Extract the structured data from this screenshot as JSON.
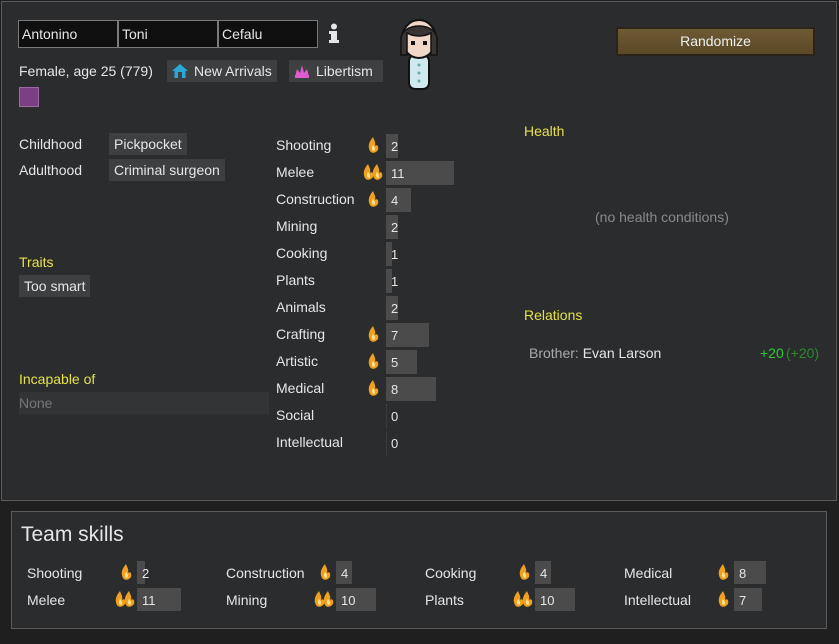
{
  "names": {
    "first": "Antonino",
    "nick": "Toni",
    "last": "Cefalu"
  },
  "summary": "Female, age 25 (779)",
  "faction_chips": [
    {
      "label": "New Arrivals",
      "icon": "house-icon"
    },
    {
      "label": "Libertism",
      "icon": "ideology-icon"
    }
  ],
  "randomize_label": "Randomize",
  "backstory": {
    "childhood_label": "Childhood",
    "childhood": "Pickpocket",
    "adulthood_label": "Adulthood",
    "adulthood": "Criminal surgeon"
  },
  "traits_title": "Traits",
  "traits": [
    "Too smart"
  ],
  "incapable_title": "Incapable of",
  "incapable_value": "None",
  "health_title": "Health",
  "health_empty": "(no health conditions)",
  "relations_title": "Relations",
  "relations": [
    {
      "type": "Brother:",
      "name": "Evan Larson",
      "opinion": "+20",
      "opinion_base": "(+20)"
    }
  ],
  "skills": [
    {
      "name": "Shooting",
      "level": 2,
      "passion": 1
    },
    {
      "name": "Melee",
      "level": 11,
      "passion": 2
    },
    {
      "name": "Construction",
      "level": 4,
      "passion": 1
    },
    {
      "name": "Mining",
      "level": 2,
      "passion": 0
    },
    {
      "name": "Cooking",
      "level": 1,
      "passion": 0
    },
    {
      "name": "Plants",
      "level": 1,
      "passion": 0
    },
    {
      "name": "Animals",
      "level": 2,
      "passion": 0
    },
    {
      "name": "Crafting",
      "level": 7,
      "passion": 1
    },
    {
      "name": "Artistic",
      "level": 5,
      "passion": 1
    },
    {
      "name": "Medical",
      "level": 8,
      "passion": 1
    },
    {
      "name": "Social",
      "level": 0,
      "passion": 0
    },
    {
      "name": "Intellectual",
      "level": 0,
      "passion": 0
    }
  ],
  "team_title": "Team skills",
  "team_skills": [
    {
      "name": "Shooting",
      "level": 2,
      "passion": 1
    },
    {
      "name": "Construction",
      "level": 4,
      "passion": 1
    },
    {
      "name": "Cooking",
      "level": 4,
      "passion": 1
    },
    {
      "name": "Medical",
      "level": 8,
      "passion": 1
    },
    {
      "name": "Melee",
      "level": 11,
      "passion": 2
    },
    {
      "name": "Mining",
      "level": 10,
      "passion": 2
    },
    {
      "name": "Plants",
      "level": 10,
      "passion": 2
    },
    {
      "name": "Intellectual",
      "level": 7,
      "passion": 1
    }
  ],
  "colors": {
    "accent_yellow": "#e6e14b",
    "positive": "#2ecc2e",
    "favorite_color": "#7b3f84",
    "button": "#6e5a33"
  }
}
